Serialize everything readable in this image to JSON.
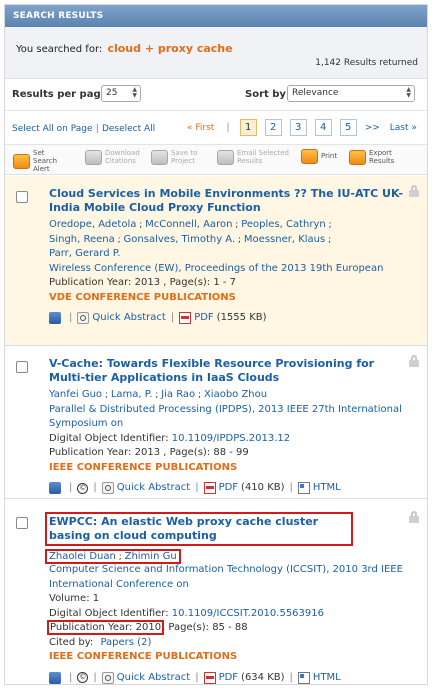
{
  "header": {
    "title": "SEARCH RESULTS"
  },
  "search": {
    "label": "You searched for:",
    "query": "cloud + proxy cache",
    "results_count": "1,142 Results returned"
  },
  "controls": {
    "rpp_label": "Results per page",
    "rpp_value": "25",
    "sort_label": "Sort by:",
    "sort_value": "Relevance"
  },
  "selection": {
    "select_all": "Select All on Page",
    "separator": "|",
    "deselect_all": "Deselect All"
  },
  "pager": {
    "first": "« First",
    "separator": "|",
    "pages": [
      "1",
      "2",
      "3",
      "4",
      "5"
    ],
    "active_page": "1",
    "more": ">>",
    "last": "Last »"
  },
  "toolbar": [
    {
      "label": "Set Search Alert",
      "icon": "alert-icon",
      "enabled": true
    },
    {
      "label": "Download Citations",
      "icon": "download-icon",
      "enabled": false
    },
    {
      "label": "Save to Project",
      "icon": "save-icon",
      "enabled": false
    },
    {
      "label": "Email Selected Results",
      "icon": "email-icon",
      "enabled": false
    },
    {
      "label": "Print",
      "icon": "print-icon",
      "enabled": true
    },
    {
      "label": "Export Results",
      "icon": "export-icon",
      "enabled": true
    }
  ],
  "results": [
    {
      "title": "Cloud Services in Mobile Environments ?? The IU-ATC UK-India Mobile Cloud Proxy Function",
      "authors": [
        "Oredope, Adetola",
        "McConnell, Aaron",
        "Peoples, Cathryn",
        "Singh, Reena",
        "Gonsalves, Timothy A.",
        "Moessner, Klaus",
        "Parr, Gerard P."
      ],
      "publication": "Wireless Conference (EW), Proceedings of the 2013 19th European",
      "pub_year_line": "Publication Year: 2013 , Page(s): 1 - 7",
      "conference": "VDE CONFERENCE PUBLICATIONS",
      "quick_abstract": "Quick Abstract",
      "pdf": "PDF",
      "pdf_size": "(1555 KB)"
    },
    {
      "title": "V-Cache: Towards Flexible Resource Provisioning for Multi-tier Applications in IaaS Clouds",
      "authors": [
        "Yanfei Guo",
        "Lama, P.",
        "Jia Rao",
        "Xiaobo Zhou"
      ],
      "publication": "Parallel & Distributed Processing (IPDPS), 2013 IEEE 27th International Symposium on",
      "doi_label": "Digital Object Identifier:",
      "doi": "10.1109/IPDPS.2013.12",
      "pub_year_line": "Publication Year: 2013 , Page(s): 88 - 99",
      "conference": "IEEE CONFERENCE PUBLICATIONS",
      "quick_abstract": "Quick Abstract",
      "pdf": "PDF",
      "pdf_size": "(410 KB)",
      "html": "HTML"
    },
    {
      "title": "EWPCC: An elastic Web proxy cache cluster basing on cloud computing",
      "authors": [
        "Zhaolei Duan",
        "Zhimin Gu"
      ],
      "publication": "Computer Science and Information Technology (ICCSIT), 2010 3rd IEEE International Conference on",
      "volume": "Volume: 1",
      "doi_label": "Digital Object Identifier:",
      "doi": "10.1109/ICCSIT.2010.5563916",
      "pub_year": "Publication Year: 2010",
      "pages": ", Page(s): 85 - 88",
      "cited_label": "Cited by:",
      "cited": "Papers (2)",
      "conference": "IEEE CONFERENCE PUBLICATIONS",
      "quick_abstract": "Quick Abstract",
      "pdf": "PDF",
      "pdf_size": "(634 KB)",
      "html": "HTML"
    }
  ],
  "colors": {
    "link": "#1a5fa5",
    "accent_orange": "#e36c16",
    "header_blue": "#6b90bd",
    "highlight_bg": "#fff7e4",
    "annotation_red": "#d21a1a"
  }
}
